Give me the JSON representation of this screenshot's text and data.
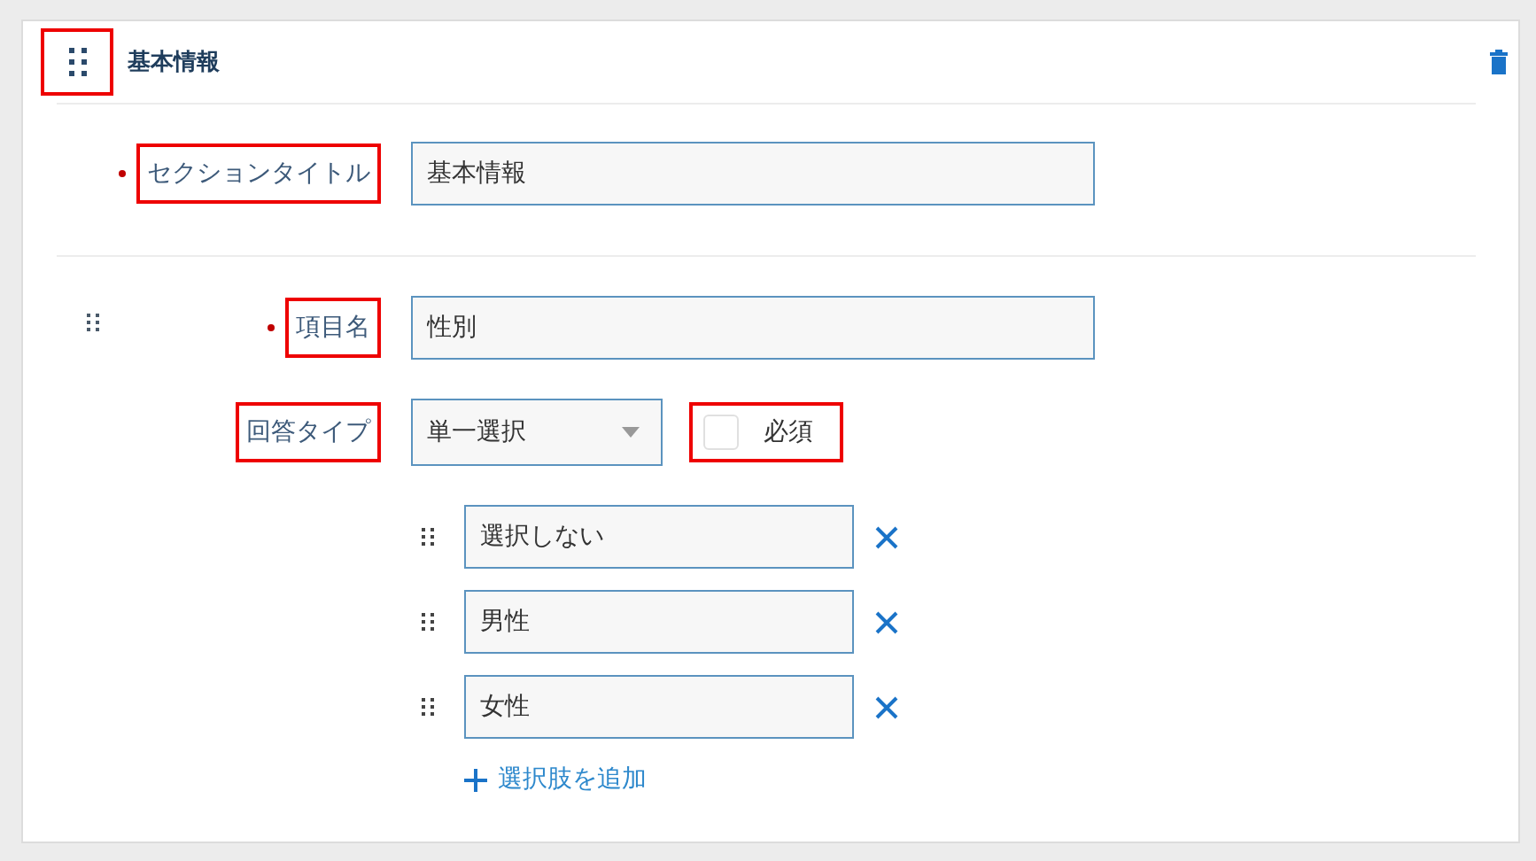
{
  "section": {
    "title": "基本情報",
    "handle_highlighted": true,
    "title_field": {
      "label": "セクションタイトル",
      "required": true,
      "highlighted": true,
      "value": "基本情報"
    },
    "item": {
      "name_field": {
        "label": "項目名",
        "required": true,
        "highlighted": true,
        "value": "性別"
      },
      "answer_type": {
        "label": "回答タイプ",
        "highlighted": true,
        "value": "単一選択"
      },
      "required_checkbox": {
        "label": "必須",
        "checked": false
      },
      "required_frame_highlighted": true,
      "options": [
        {
          "value": "選択しない"
        },
        {
          "value": "男性"
        },
        {
          "value": "女性"
        }
      ],
      "add_option": "選択肢を追加"
    }
  }
}
